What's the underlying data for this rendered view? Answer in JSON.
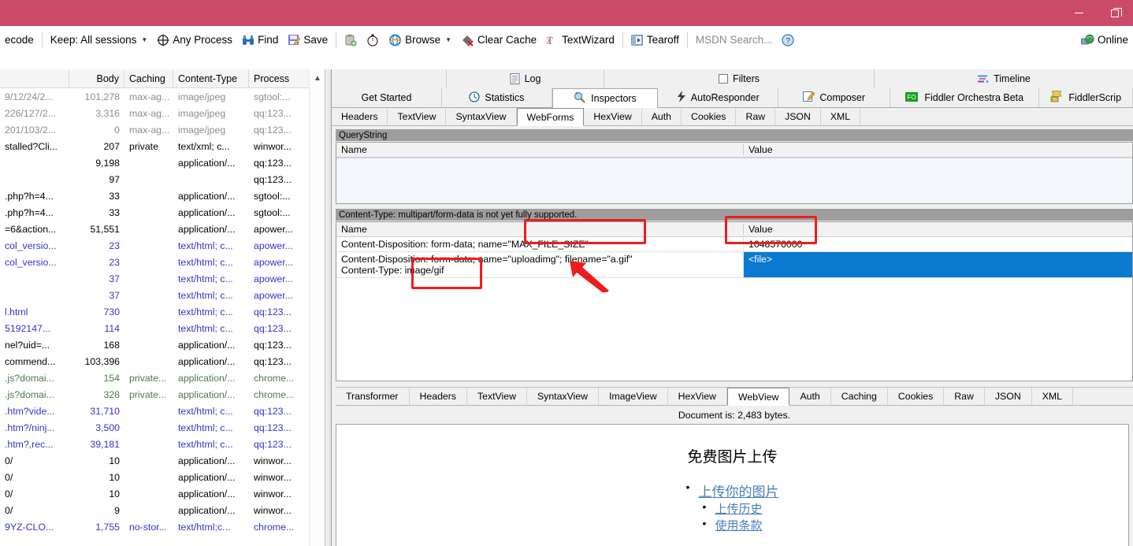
{
  "window": {
    "titlebar_color": "#c94b68",
    "minimize_label": "Minimize",
    "restore_label": "Restore"
  },
  "toolbar": {
    "decode_label": "ecode",
    "keep_label": "Keep: All sessions",
    "any_process_label": "Any Process",
    "find_label": "Find",
    "save_label": "Save",
    "browse_label": "Browse",
    "clear_cache_label": "Clear Cache",
    "text_wizard_label": "TextWizard",
    "tearoff_label": "Tearoff",
    "msdn_search_placeholder": "MSDN Search...",
    "online_label": "Online"
  },
  "sessions": {
    "columns": [
      "",
      "Body",
      "Caching",
      "Content-Type",
      "Process"
    ],
    "rows": [
      {
        "url": "9/12/24/2...",
        "body": "101,278",
        "caching": "max-ag...",
        "ctype": "image/jpeg",
        "process": "sgtool:...",
        "color": "#8c8c8c"
      },
      {
        "url": "226/127/2...",
        "body": "3,316",
        "caching": "max-ag...",
        "ctype": "image/jpeg",
        "process": "qq:123...",
        "color": "#8c8c8c"
      },
      {
        "url": "201/103/2...",
        "body": "0",
        "caching": "max-ag...",
        "ctype": "image/jpeg",
        "process": "qq:123...",
        "color": "#8c8c8c"
      },
      {
        "url": "stalled?Cli...",
        "body": "207",
        "caching": "private",
        "ctype": "text/xml; c...",
        "process": "winwor...",
        "color": "#000000"
      },
      {
        "url": "",
        "body": "9,198",
        "caching": "",
        "ctype": "application/...",
        "process": "qq:123...",
        "color": "#000000"
      },
      {
        "url": "",
        "body": "97",
        "caching": "",
        "ctype": "",
        "process": "qq:123...",
        "color": "#000000"
      },
      {
        "url": ".php?h=4...",
        "body": "33",
        "caching": "",
        "ctype": "application/...",
        "process": "sgtool:...",
        "color": "#000000"
      },
      {
        "url": ".php?h=4...",
        "body": "33",
        "caching": "",
        "ctype": "application/...",
        "process": "sgtool:...",
        "color": "#000000"
      },
      {
        "url": "=6&action...",
        "body": "51,551",
        "caching": "",
        "ctype": "application/...",
        "process": "apower...",
        "color": "#000000"
      },
      {
        "url": "col_versio...",
        "body": "23",
        "caching": "",
        "ctype": "text/html; c...",
        "process": "apower...",
        "color": "#3333cc"
      },
      {
        "url": "col_versio...",
        "body": "23",
        "caching": "",
        "ctype": "text/html; c...",
        "process": "apower...",
        "color": "#3333cc"
      },
      {
        "url": "",
        "body": "37",
        "caching": "",
        "ctype": "text/html; c...",
        "process": "apower...",
        "color": "#3333cc"
      },
      {
        "url": "",
        "body": "37",
        "caching": "",
        "ctype": "text/html; c...",
        "process": "apower...",
        "color": "#3333cc"
      },
      {
        "url": "l.html",
        "body": "730",
        "caching": "",
        "ctype": "text/html; c...",
        "process": "qq:123...",
        "color": "#3333cc"
      },
      {
        "url": "5192147...",
        "body": "114",
        "caching": "",
        "ctype": "text/html; c...",
        "process": "qq:123...",
        "color": "#3333cc"
      },
      {
        "url": "nel?uid=...",
        "body": "168",
        "caching": "",
        "ctype": "application/...",
        "process": "qq:123...",
        "color": "#000000"
      },
      {
        "url": "commend...",
        "body": "103,396",
        "caching": "",
        "ctype": "application/...",
        "process": "qq:123...",
        "color": "#000000"
      },
      {
        "url": ".js?domai...",
        "body": "154",
        "caching": "private...",
        "ctype": "application/...",
        "process": "chrome...",
        "color": "#4a7a4a"
      },
      {
        "url": ".js?domai...",
        "body": "328",
        "caching": "private...",
        "ctype": "application/...",
        "process": "chrome...",
        "color": "#4a7a4a"
      },
      {
        "url": ".htm?vide...",
        "body": "31,710",
        "caching": "",
        "ctype": "text/html; c...",
        "process": "qq:123...",
        "color": "#3333cc"
      },
      {
        "url": ".htm?/ninj...",
        "body": "3,500",
        "caching": "",
        "ctype": "text/html; c...",
        "process": "qq:123...",
        "color": "#3333cc"
      },
      {
        "url": ".htm?,rec...",
        "body": "39,181",
        "caching": "",
        "ctype": "text/html; c...",
        "process": "qq:123...",
        "color": "#3333cc"
      },
      {
        "url": "0/",
        "body": "10",
        "caching": "",
        "ctype": "application/...",
        "process": "winwor...",
        "color": "#000000"
      },
      {
        "url": "0/",
        "body": "10",
        "caching": "",
        "ctype": "application/...",
        "process": "winwor...",
        "color": "#000000"
      },
      {
        "url": "0/",
        "body": "10",
        "caching": "",
        "ctype": "application/...",
        "process": "winwor...",
        "color": "#000000"
      },
      {
        "url": "0/",
        "body": "9",
        "caching": "",
        "ctype": "application/...",
        "process": "winwor...",
        "color": "#000000"
      },
      {
        "url": "9YZ-CLO...",
        "body": "1,755",
        "caching": "no-stor...",
        "ctype": "text/html;c...",
        "process": "chrome...",
        "color": "#3333cc"
      }
    ]
  },
  "rightpane": {
    "toprow": {
      "log_label": "Log",
      "filters_label": "Filters",
      "timeline_label": "Timeline"
    },
    "main_tabs": [
      {
        "label": "Get Started",
        "active": false
      },
      {
        "label": "Statistics",
        "active": false
      },
      {
        "label": "Inspectors",
        "active": true
      },
      {
        "label": "AutoResponder",
        "active": false
      },
      {
        "label": "Composer",
        "active": false
      },
      {
        "label": "Fiddler Orchestra Beta",
        "active": false
      },
      {
        "label": "FiddlerScrip",
        "active": false
      }
    ],
    "request_tabs": [
      {
        "label": "Headers",
        "active": false
      },
      {
        "label": "TextView",
        "active": false
      },
      {
        "label": "SyntaxView",
        "active": false
      },
      {
        "label": "WebForms",
        "active": true
      },
      {
        "label": "HexView",
        "active": false
      },
      {
        "label": "Auth",
        "active": false
      },
      {
        "label": "Cookies",
        "active": false
      },
      {
        "label": "Raw",
        "active": false
      },
      {
        "label": "JSON",
        "active": false
      },
      {
        "label": "XML",
        "active": false
      }
    ],
    "webforms": {
      "querystring_title": "QueryString",
      "qs_col_name": "Name",
      "qs_col_value": "Value",
      "body_notice": "Content-Type: multipart/form-data is not yet fully supported.",
      "body_col_name": "Name",
      "body_col_value": "Value",
      "rows": [
        {
          "name": "Content-Disposition: form-data; name=\"MAX_FILE_SIZE\"",
          "value": "1048576000",
          "selected": false
        },
        {
          "name": "Content-Disposition: form-data; name=\"uploadimg\"; filename=\"a.gif\"",
          "name2": "Content-Type: image/gif",
          "value": "<file>",
          "selected": true
        }
      ],
      "annotation_color": "#ef1c1c",
      "selection_color": "#0b7ad1"
    },
    "response_tabs": [
      {
        "label": "Transformer",
        "active": false
      },
      {
        "label": "Headers",
        "active": false
      },
      {
        "label": "TextView",
        "active": false
      },
      {
        "label": "SyntaxView",
        "active": false
      },
      {
        "label": "ImageView",
        "active": false
      },
      {
        "label": "HexView",
        "active": false
      },
      {
        "label": "WebView",
        "active": true
      },
      {
        "label": "Auth",
        "active": false
      },
      {
        "label": "Caching",
        "active": false
      },
      {
        "label": "Cookies",
        "active": false
      },
      {
        "label": "Raw",
        "active": false
      },
      {
        "label": "JSON",
        "active": false
      },
      {
        "label": "XML",
        "active": false
      }
    ],
    "document_info": "Document is: 2,483 bytes.",
    "webview": {
      "heading": "免费图片上传",
      "links": [
        "上传你的图片",
        "上传历史",
        "使用条款"
      ],
      "link_color": "#4a7ebb"
    }
  }
}
